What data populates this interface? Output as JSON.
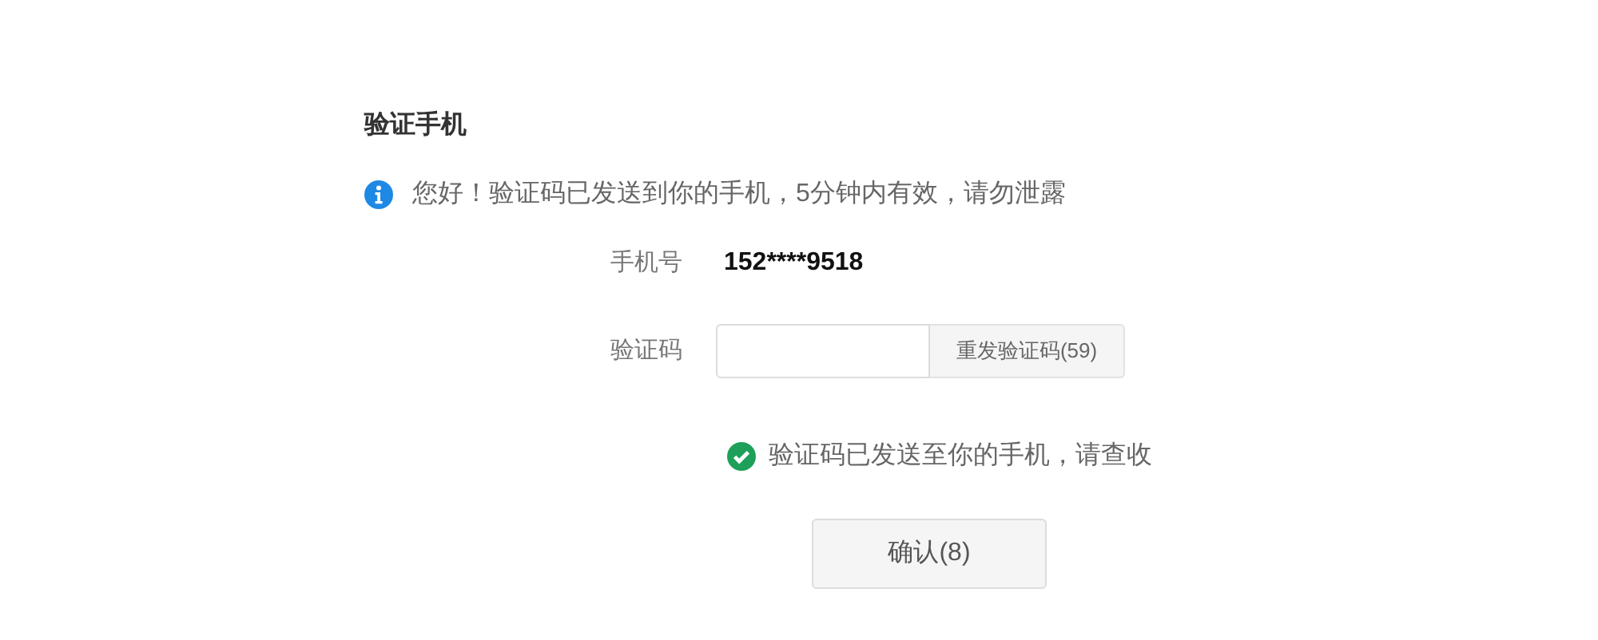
{
  "title": "验证手机",
  "notice": "您好！验证码已发送到你的手机，5分钟内有效，请勿泄露",
  "phone": {
    "label": "手机号",
    "value": "152****9518"
  },
  "code": {
    "label": "验证码",
    "resend_button": "重发验证码(59)"
  },
  "success_message": "验证码已发送至你的手机，请查收",
  "confirm_button": "确认(8)"
}
